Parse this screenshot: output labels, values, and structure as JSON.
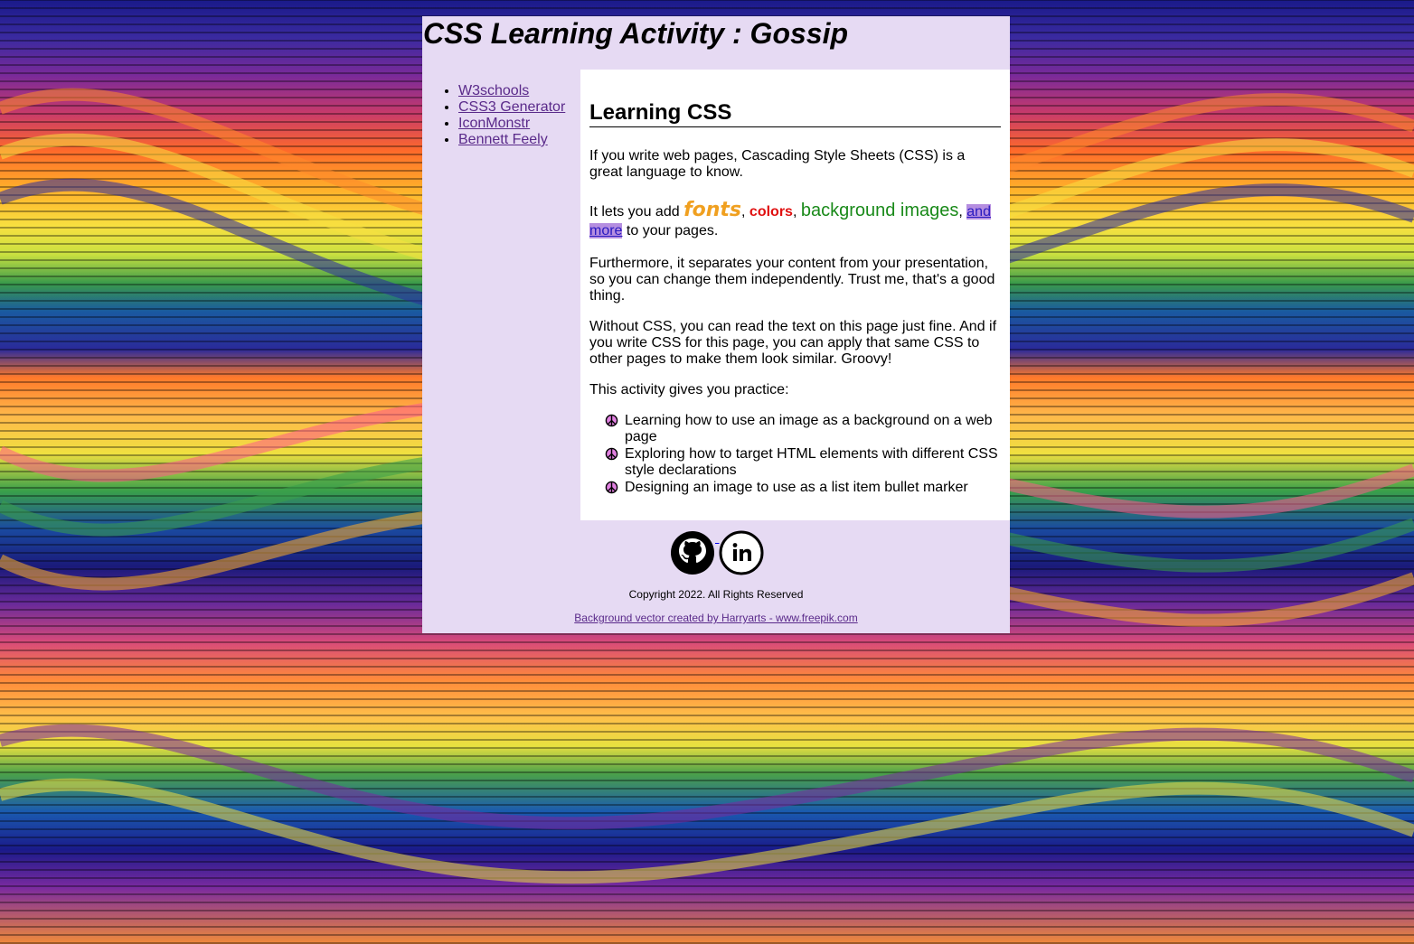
{
  "header": {
    "title": "CSS Learning Activity : Gossip"
  },
  "sidebar": {
    "links": [
      {
        "label": "W3schools"
      },
      {
        "label": "CSS3 Generator"
      },
      {
        "label": "IconMonstr"
      },
      {
        "label": "Bennett Feely"
      }
    ]
  },
  "main": {
    "heading": "Learning CSS",
    "p1": "If you write web pages, Cascading Style Sheets (CSS) is a great language to know.",
    "p2": {
      "lead": "It lets you add ",
      "fonts": "fonts",
      "sep1": ", ",
      "colors": "colors",
      "sep2": ", ",
      "background_images": "background images",
      "sep3": ", ",
      "more_link": "and more",
      "tail": " to your pages."
    },
    "p3": "Furthermore, it separates your content from your presentation, so you can change them independently. Trust me, that's a good thing.",
    "p4": "Without CSS, you can read the text on this page just fine. And if you write CSS for this page, you can apply that same CSS to other pages to make them look similar. Groovy!",
    "p5": "This activity gives you practice:",
    "practice_items": [
      "Learning how to use an image as a background on a web page",
      "Exploring how to target HTML elements with different CSS style declarations",
      "Designing an image to use as a list item bullet marker"
    ]
  },
  "footer": {
    "social_icons": [
      "github-icon",
      "linkedin-icon"
    ],
    "copyright": "Copyright 2022. All Rights Reserved",
    "credit": "Background vector created by Harryarts - www.freepik.com"
  },
  "colors": {
    "container_bg": "#e6daf3",
    "main_bg": "#ffffff",
    "link": "#5a2a8a",
    "fonts_word": "#f0a020",
    "colors_word": "#e01010",
    "bgimg_word": "#1a8a1a"
  }
}
